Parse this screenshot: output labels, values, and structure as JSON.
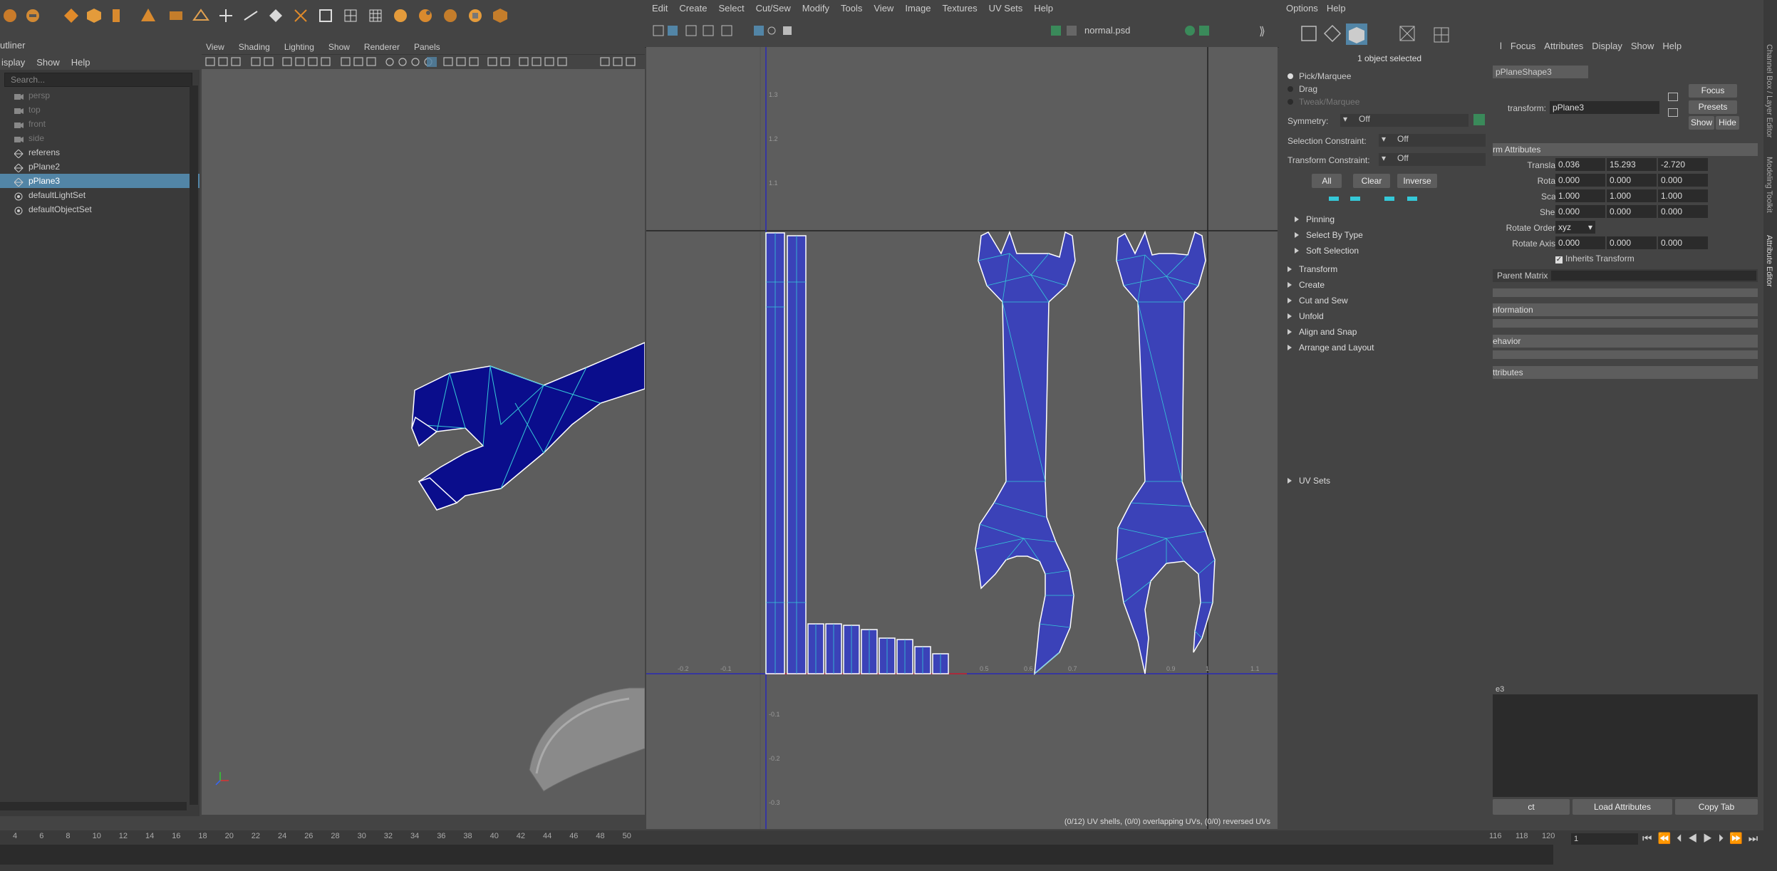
{
  "outliner": {
    "title": "utliner",
    "menu": [
      "isplay",
      "Show",
      "Help"
    ],
    "search_placeholder": "Search...",
    "items": [
      {
        "label": "persp",
        "state": "dim",
        "icon": "camera-icon"
      },
      {
        "label": "top",
        "state": "dim",
        "icon": "camera-icon"
      },
      {
        "label": "front",
        "state": "dim",
        "icon": "camera-icon"
      },
      {
        "label": "side",
        "state": "dim",
        "icon": "camera-icon"
      },
      {
        "label": "referens",
        "state": "normal",
        "icon": "mesh-icon"
      },
      {
        "label": "pPlane2",
        "state": "normal",
        "icon": "mesh-icon"
      },
      {
        "label": "pPlane3",
        "state": "selected",
        "icon": "mesh-icon"
      },
      {
        "label": "defaultLightSet",
        "state": "normal",
        "icon": "set-icon"
      },
      {
        "label": "defaultObjectSet",
        "state": "normal",
        "icon": "set-icon"
      }
    ]
  },
  "viewport": {
    "menu": [
      "View",
      "Shading",
      "Lighting",
      "Show",
      "Renderer",
      "Panels"
    ]
  },
  "uv_editor": {
    "menu": [
      "Edit",
      "Create",
      "Select",
      "Cut/Sew",
      "Modify",
      "Tools",
      "View",
      "Image",
      "Textures",
      "UV Sets",
      "Help"
    ],
    "image_name": "normal.psd",
    "status": "(0/12) UV shells, (0/0) overlapping UVs, (0/0) reversed UVs",
    "u_labels": [
      "-0.2",
      "-0.1",
      "0.5",
      "0.6",
      "0.7",
      "0.9",
      "1",
      "1.1"
    ],
    "v_labels": [
      "1.3",
      "1.2",
      "1.1",
      "-0.1",
      "-0.2",
      "-0.3"
    ]
  },
  "uv_toolkit": {
    "menu": [
      "Options",
      "Help"
    ],
    "selection_info": "1 object selected",
    "modes": [
      "Pick/Marquee",
      "Drag",
      "Tweak/Marquee"
    ],
    "symmetry_label": "Symmetry:",
    "symmetry_value": "Off",
    "selection_constraint_label": "Selection Constraint:",
    "selection_constraint_value": "Off",
    "transform_constraint_label": "Transform Constraint:",
    "transform_constraint_value": "Off",
    "buttons": {
      "all": "All",
      "clear": "Clear",
      "inverse": "Inverse"
    },
    "subsections": [
      "Pinning",
      "Select By Type",
      "Soft Selection"
    ],
    "sections": [
      "Transform",
      "Create",
      "Cut and Sew",
      "Unfold",
      "Align and Snap",
      "Arrange and Layout"
    ],
    "uv_sets": "UV Sets"
  },
  "attribute_editor": {
    "menu": [
      "l",
      "Focus",
      "Attributes",
      "Display",
      "Show",
      "Help"
    ],
    "tab": "pPlaneShape3",
    "transform_label": "transform:",
    "transform_value": "pPlane3",
    "buttons": {
      "focus": "Focus",
      "presets": "Presets",
      "show": "Show",
      "hide": "Hide"
    },
    "section_title": "rm Attributes",
    "translate_label": "Translate",
    "translate": [
      "0.036",
      "15.293",
      "-2.720"
    ],
    "rotate_label": "Rotate",
    "rotate": [
      "0.000",
      "0.000",
      "0.000"
    ],
    "scale_label": "Scale",
    "scale": [
      "1.000",
      "1.000",
      "1.000"
    ],
    "shear_label": "Shear",
    "shear": [
      "0.000",
      "0.000",
      "0.000"
    ],
    "rotate_order_label": "Rotate Order",
    "rotate_order": "xyz",
    "rotate_axis_label": "Rotate Axis",
    "rotate_axis": [
      "0.000",
      "0.000",
      "0.000"
    ],
    "inherits_transform": "Inherits Transform",
    "parent_matrix": "Parent Matrix",
    "collapsed_sections": [
      "nformation",
      "ehavior",
      "ttributes"
    ],
    "notes_label": "e3",
    "bottom_buttons": [
      "ct",
      "Load Attributes",
      "Copy Tab"
    ]
  },
  "side_tabs": [
    "Channel Box / Layer Editor",
    "Modeling Toolkit",
    "Attribute Editor"
  ],
  "timeline": {
    "ticks": [
      "4",
      "6",
      "8",
      "10",
      "12",
      "14",
      "16",
      "18",
      "20",
      "22",
      "24",
      "26",
      "28",
      "30",
      "32",
      "34",
      "36",
      "38",
      "40",
      "42",
      "44",
      "46",
      "48",
      "50"
    ],
    "right_ticks": [
      "116",
      "118",
      "120"
    ],
    "current_frame": "1"
  },
  "colors": {
    "uv_shell_fill": "#3b42b8",
    "uv_edge": "#35c8d8",
    "mesh_fill": "#0a0d8c",
    "selection": "#5285a6"
  }
}
